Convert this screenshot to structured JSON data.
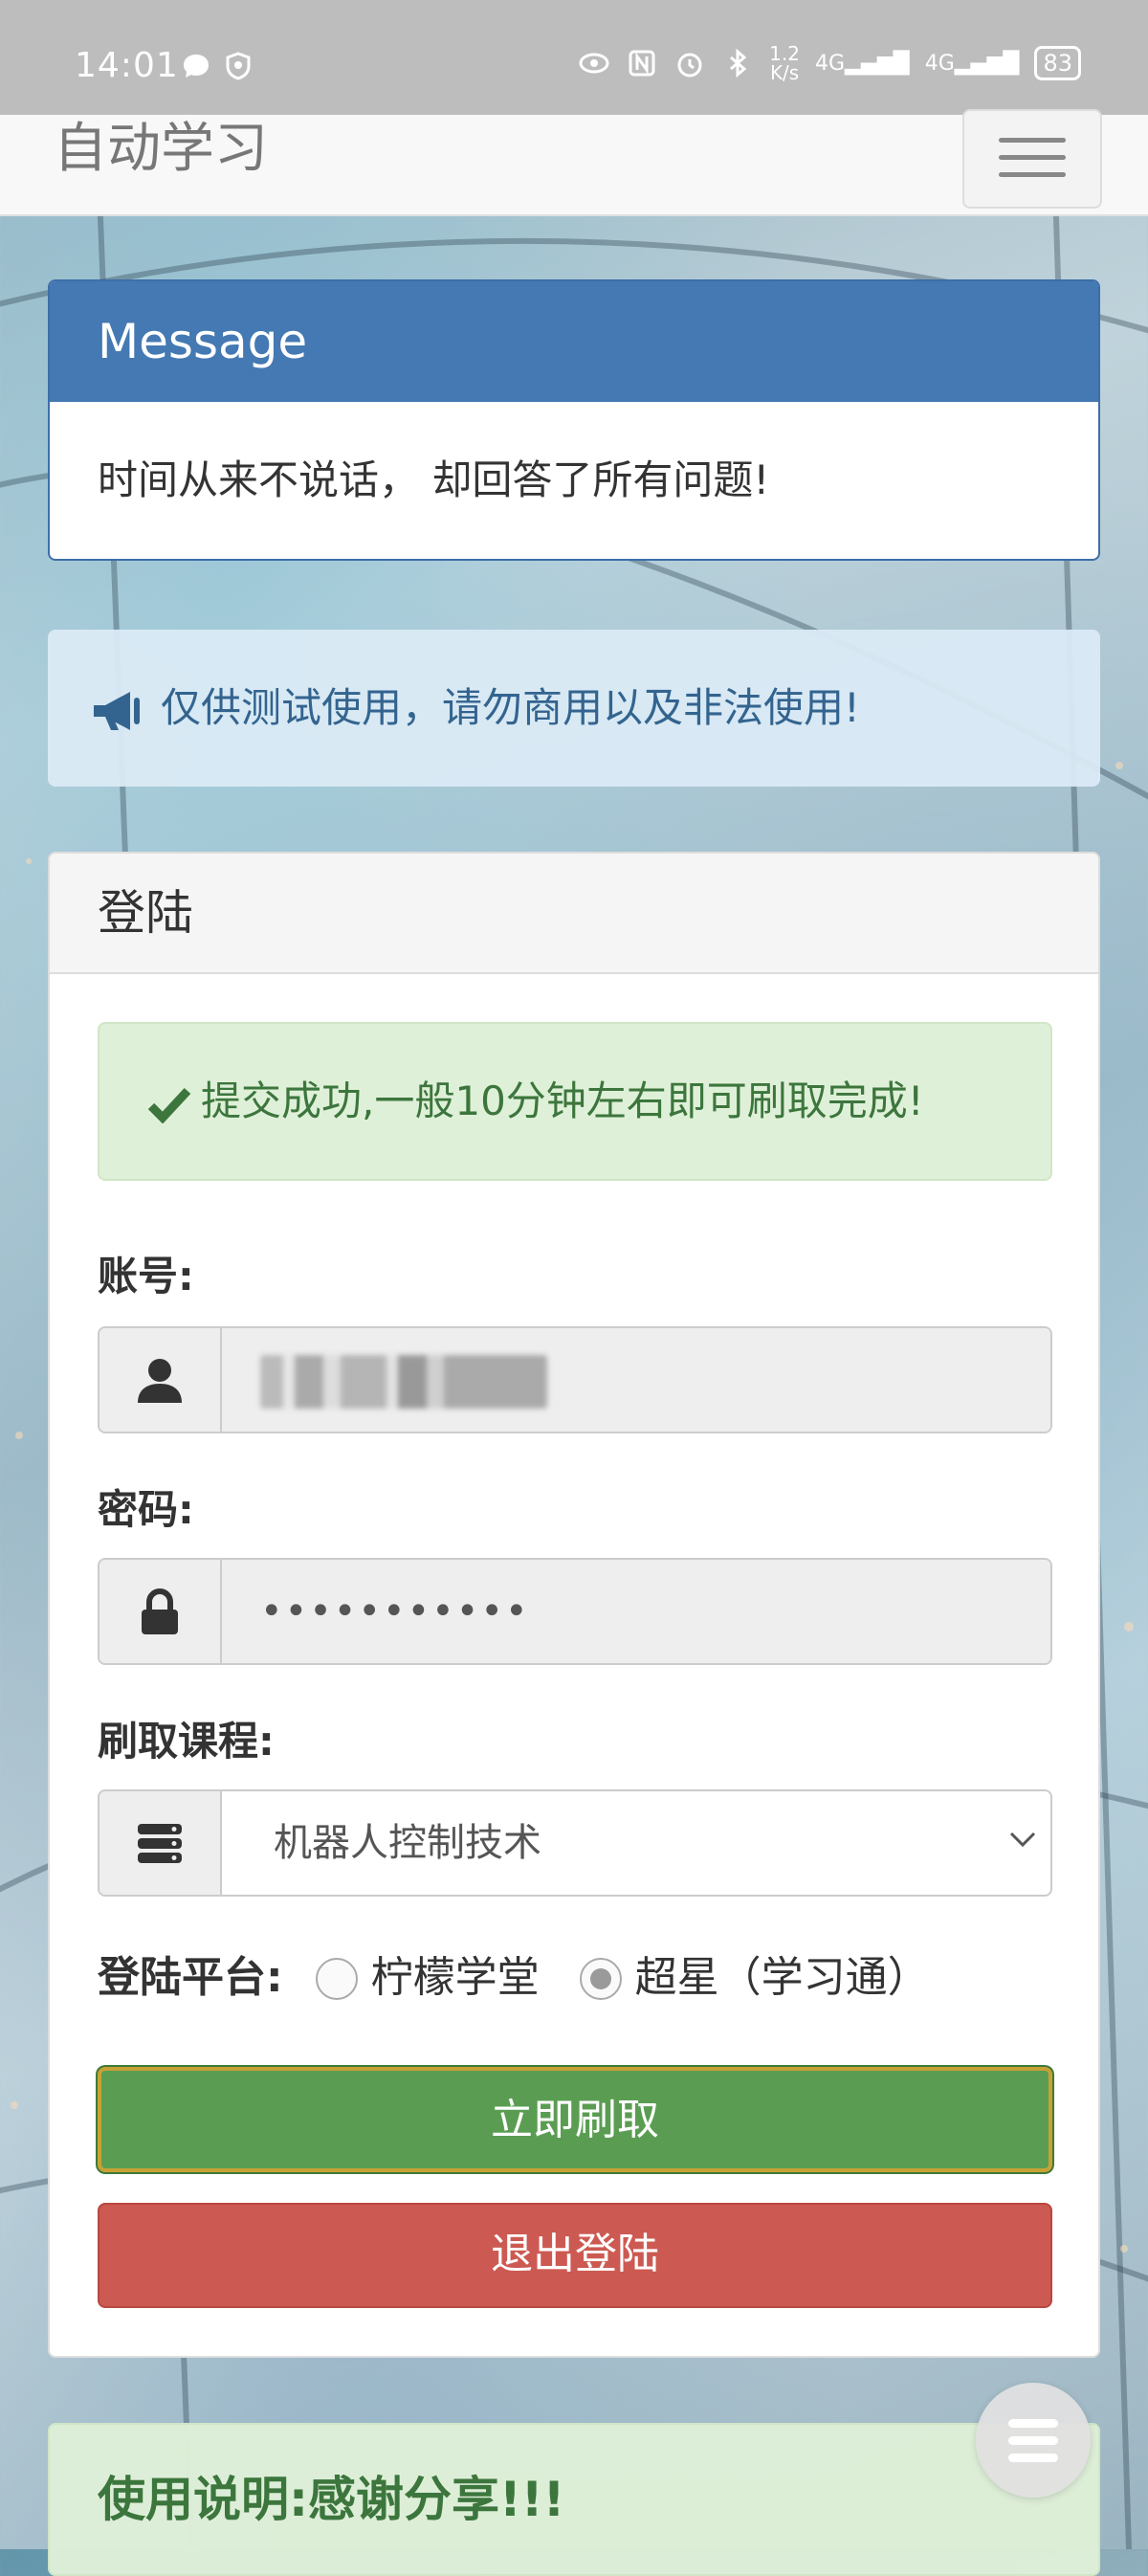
{
  "status_bar": {
    "time": "14:01",
    "net_speed_value": "1.2",
    "net_speed_unit": "K/s",
    "signal1": "4G",
    "signal2": "4G",
    "battery": "83"
  },
  "navbar": {
    "brand": "自动学习"
  },
  "message_panel": {
    "title": "Message",
    "body": "时间从来不说话， 却回答了所有问题!"
  },
  "notice": {
    "icon": "megaphone-icon",
    "text": "仅供测试使用，请勿商用以及非法使用!"
  },
  "login": {
    "title": "登陆",
    "success_alert": "提交成功,一般10分钟左右即可刷取完成!",
    "account_label": "账号:",
    "password_label": "密码:",
    "password_value": "•••••••••••",
    "course_label": "刷取课程:",
    "course_selected": "机器人控制技术",
    "platform_label": "登陆平台:",
    "platform_options": [
      {
        "label": "柠檬学堂",
        "selected": false
      },
      {
        "label": "超星（学习通）",
        "selected": true
      }
    ],
    "submit_button": "立即刷取",
    "logout_button": "退出登陆"
  },
  "usage": {
    "title": "使用说明:感谢分享!!!"
  },
  "colors": {
    "primary": "#4479b3",
    "success": "#5a9d52",
    "danger": "#cc5a52",
    "info_bg": "#dff0d8"
  }
}
